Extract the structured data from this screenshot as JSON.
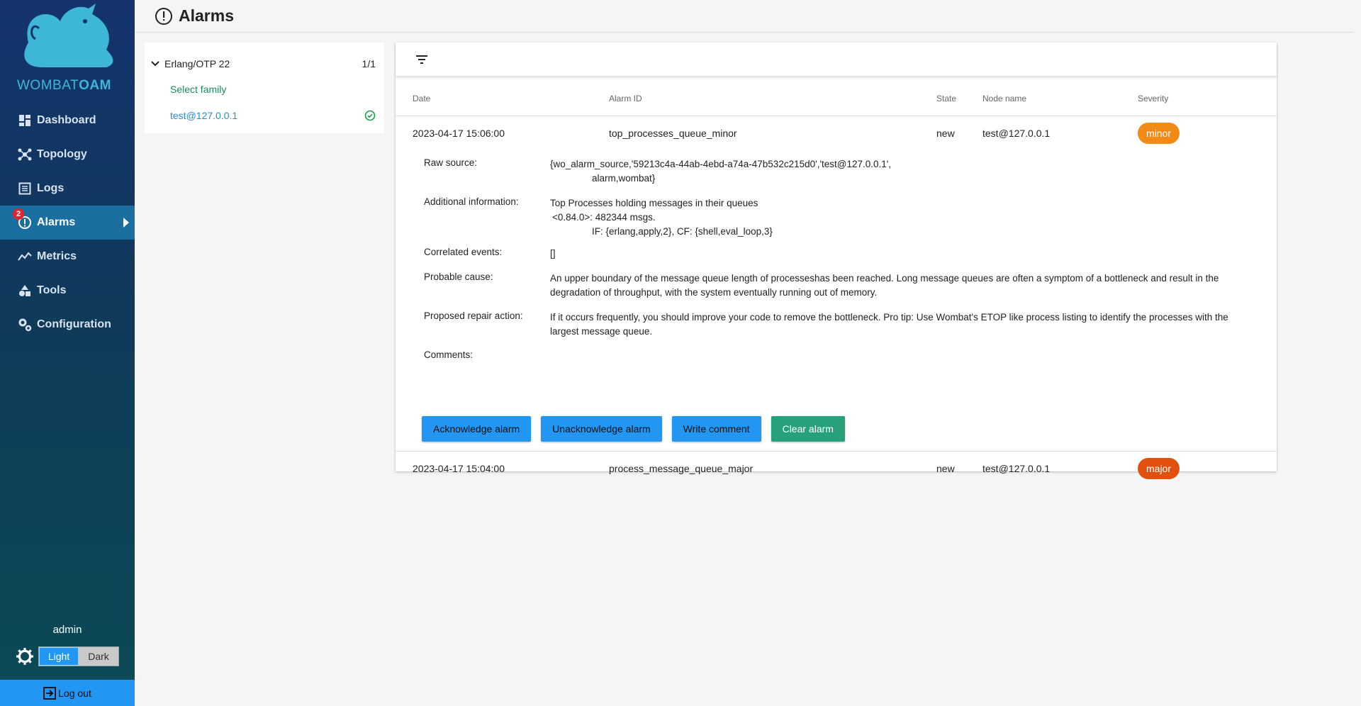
{
  "app": {
    "logo_text_a": "WOMBAT",
    "logo_text_b": "OAM"
  },
  "sidebar": {
    "items": [
      {
        "label": "Dashboard",
        "icon": "dashboard-icon"
      },
      {
        "label": "Topology",
        "icon": "topology-icon"
      },
      {
        "label": "Logs",
        "icon": "logs-icon"
      },
      {
        "label": "Alarms",
        "icon": "alarm-icon",
        "badge": "2",
        "active": true
      },
      {
        "label": "Metrics",
        "icon": "metrics-icon"
      },
      {
        "label": "Tools",
        "icon": "tools-icon"
      },
      {
        "label": "Configuration",
        "icon": "configuration-icon"
      }
    ],
    "user": "admin",
    "theme_light": "Light",
    "theme_dark": "Dark",
    "logout": "Log out"
  },
  "header": {
    "title": "Alarms"
  },
  "tree": {
    "family": "Erlang/OTP 22",
    "count": "1/1",
    "select_family": "Select family",
    "node": "test@127.0.0.1"
  },
  "table": {
    "columns": [
      "Date",
      "Alarm ID",
      "State",
      "Node name",
      "Severity"
    ],
    "rows": [
      {
        "date": "2023-04-17 15:06:00",
        "alarm_id": "top_processes_queue_minor",
        "state": "new",
        "node": "test@127.0.0.1",
        "severity": "minor"
      },
      {
        "date": "2023-04-17 15:04:00",
        "alarm_id": "process_message_queue_major",
        "state": "new",
        "node": "test@127.0.0.1",
        "severity": "major"
      }
    ]
  },
  "details": {
    "raw_source_label": "Raw source:",
    "raw_source_line1": "{wo_alarm_source,'59213c4a-44ab-4ebd-a74a-47b532c215d0','test@127.0.0.1',",
    "raw_source_line2": "alarm,wombat}",
    "additional_label": "Additional information:",
    "additional_line1": "Top Processes holding messages in their queues",
    "additional_line2": "<0.84.0>: 482344 msgs.",
    "additional_line3": "IF: {erlang,apply,2}, CF: {shell,eval_loop,3}",
    "correlated_label": "Correlated events:",
    "correlated_value": "[]",
    "cause_label": "Probable cause:",
    "cause_value": "An upper boundary of the message queue length of processeshas been reached. Long message queues are often a symptom of a bottleneck and result in the degradation of throughput, with the system eventually running out of memory.",
    "repair_label": "Proposed repair action:",
    "repair_value": "If it occurs frequently, you should improve your code to remove the bottleneck. Pro tip: Use Wombat's ETOP like process listing to identify the processes with the largest message queue.",
    "comments_label": "Comments:",
    "buttons": {
      "acknowledge": "Acknowledge alarm",
      "unacknowledge": "Unacknowledge alarm",
      "comment": "Write comment",
      "clear": "Clear alarm"
    }
  },
  "colors": {
    "accent": "#2196f3",
    "minor": "#f28a16",
    "major": "#e2500d",
    "clear": "#26a17b"
  }
}
